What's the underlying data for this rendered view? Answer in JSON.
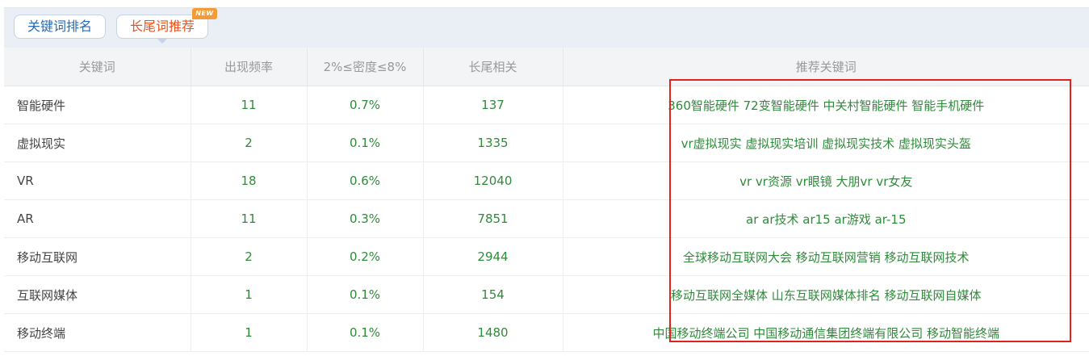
{
  "tabs": [
    {
      "label": "关键词排名"
    },
    {
      "label": "长尾词推荐",
      "badge": "NEW"
    }
  ],
  "table": {
    "headers": [
      "关键词",
      "出现频率",
      "2%≤密度≤8%",
      "长尾相关",
      "推荐关键词"
    ],
    "rows": [
      {
        "keyword": "智能硬件",
        "frequency": "11",
        "density": "0.7%",
        "longtail": "137",
        "recommend": "360智能硬件 72变智能硬件 中关村智能硬件 智能手机硬件"
      },
      {
        "keyword": "虚拟现实",
        "frequency": "2",
        "density": "0.1%",
        "longtail": "1335",
        "recommend": "vr虚拟现实 虚拟现实培训 虚拟现实技术 虚拟现实头盔"
      },
      {
        "keyword": "VR",
        "frequency": "18",
        "density": "0.6%",
        "longtail": "12040",
        "recommend": "vr vr资源 vr眼镜 大朋vr vr女友"
      },
      {
        "keyword": "AR",
        "frequency": "11",
        "density": "0.3%",
        "longtail": "7851",
        "recommend": "ar ar技术 ar15 ar游戏 ar-15"
      },
      {
        "keyword": "移动互联网",
        "frequency": "2",
        "density": "0.2%",
        "longtail": "2944",
        "recommend": "全球移动互联网大会 移动互联网营销 移动互联网技术"
      },
      {
        "keyword": "互联网媒体",
        "frequency": "1",
        "density": "0.1%",
        "longtail": "154",
        "recommend": "移动互联网全媒体 山东互联网媒体排名 移动互联网自媒体"
      },
      {
        "keyword": "移动终端",
        "frequency": "1",
        "density": "0.1%",
        "longtail": "1480",
        "recommend": "中国移动终端公司 中国移动通信集团终端有限公司 移动智能终端"
      }
    ]
  },
  "colors": {
    "highlight_box": "#e1211b",
    "link_green": "#2e8b3a",
    "active_tab": "#e8531d",
    "badge": "#f49a36"
  }
}
